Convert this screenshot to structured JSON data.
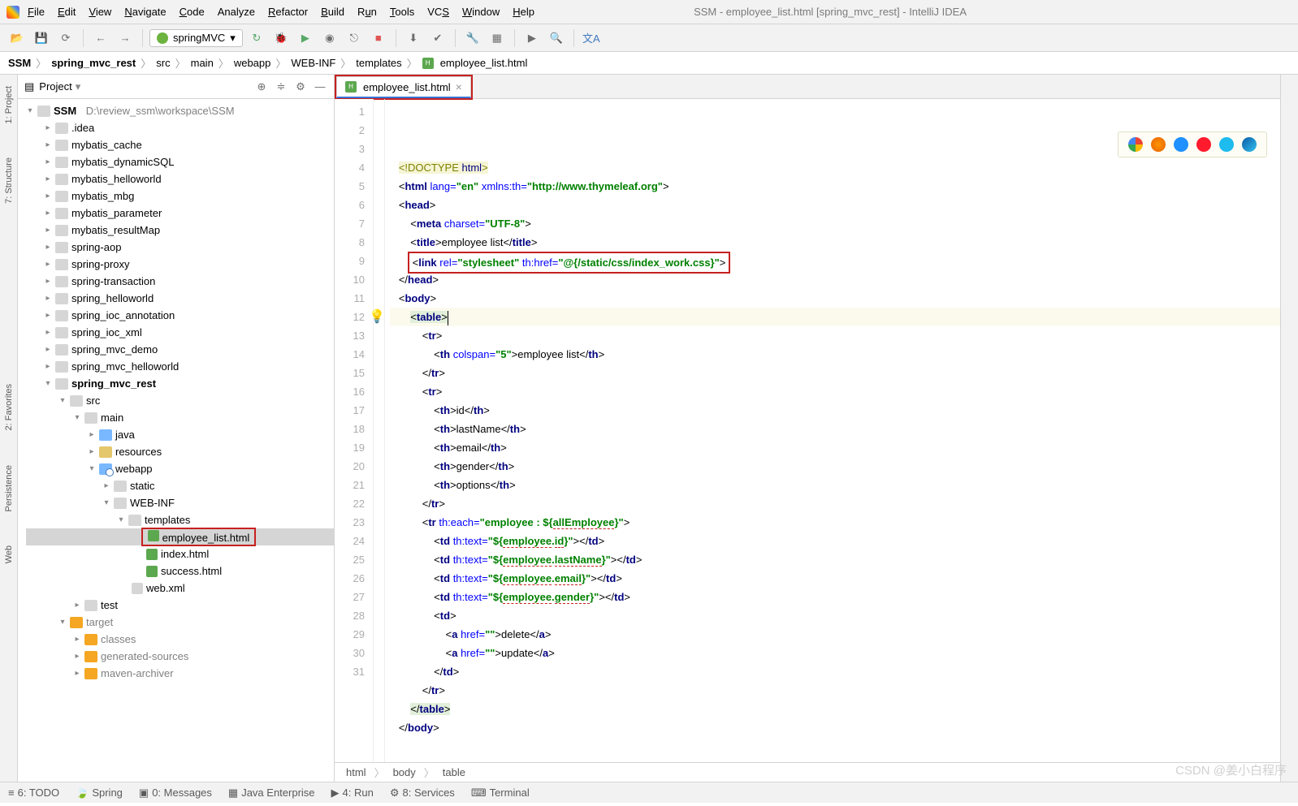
{
  "window_title": "SSM - employee_list.html [spring_mvc_rest] - IntelliJ IDEA",
  "menu": {
    "file": "File",
    "edit": "Edit",
    "view": "View",
    "navigate": "Navigate",
    "code": "Code",
    "analyze": "Analyze",
    "refactor": "Refactor",
    "build": "Build",
    "run": "Run",
    "tools": "Tools",
    "vcs": "VCS",
    "window": "Window",
    "help": "Help"
  },
  "run_config": "springMVC",
  "breadcrumbs": [
    "SSM",
    "spring_mvc_rest",
    "src",
    "main",
    "webapp",
    "WEB-INF",
    "templates",
    "employee_list.html"
  ],
  "project_panel": {
    "title": "Project"
  },
  "tree": {
    "root": "SSM",
    "root_path": "D:\\review_ssm\\workspace\\SSM",
    "mods": [
      ".idea",
      "mybatis_cache",
      "mybatis_dynamicSQL",
      "mybatis_helloworld",
      "mybatis_mbg",
      "mybatis_parameter",
      "mybatis_resultMap",
      "spring-aop",
      "spring-proxy",
      "spring-transaction",
      "spring_helloworld",
      "spring_ioc_annotation",
      "spring_ioc_xml",
      "spring_mvc_demo",
      "spring_mvc_helloworld",
      "spring_mvc_rest"
    ],
    "src": "src",
    "main": "main",
    "java": "java",
    "resources": "resources",
    "webapp": "webapp",
    "static": "static",
    "webinf": "WEB-INF",
    "templates": "templates",
    "file_emp": "employee_list.html",
    "file_index": "index.html",
    "file_success": "success.html",
    "file_web": "web.xml",
    "test": "test",
    "target": "target",
    "classes": "classes",
    "gensrc": "generated-sources",
    "archiver": "maven-archiver"
  },
  "editor": {
    "tab": "employee_list.html",
    "lines": [
      "1",
      "2",
      "3",
      "4",
      "5",
      "6",
      "7",
      "8",
      "9",
      "10",
      "11",
      "12",
      "13",
      "14",
      "15",
      "16",
      "17",
      "18",
      "19",
      "20",
      "21",
      "22",
      "23",
      "24",
      "25",
      "26",
      "27",
      "28",
      "29",
      "30",
      "31"
    ],
    "bc": [
      "html",
      "body",
      "table"
    ]
  },
  "code": {
    "doctype": "<!DOCTYPE ",
    "doctype_kw": "html",
    "html": "html",
    "lang_attr": "lang=",
    "lang_val": "\"en\"",
    "xmlns": "xmlns:th=",
    "xmlns_val": "\"http://www.thymeleaf.org\"",
    "head": "head",
    "meta": "meta",
    "charset": "charset=",
    "charset_val": "\"UTF-8\"",
    "title": "title",
    "title_txt": "employee list",
    "link": "link",
    "rel": "rel=",
    "rel_val": "\"stylesheet\"",
    "thhref": "th:href=",
    "thhref_val": "\"@{/static/css/index_work.css}\"",
    "body": "body",
    "table": "table",
    "tr": "tr",
    "th": "th",
    "td": "td",
    "a": "a",
    "href": "href=",
    "href_val": "\"\"",
    "colspan": "colspan=",
    "colspan_val": "\"5\"",
    "emp_list": "employee list",
    "id": "id",
    "lastName": "lastName",
    "email": "email",
    "gender": "gender",
    "options": "options",
    "theach": "th:each=",
    "theach_val_open": "\"employee : ${",
    "theach_var": "allEmployee",
    "theach_val_close": "}\"",
    "thtext": "th:text=",
    "expr_open": "\"${",
    "expr_close": "}\"",
    "emp": "employee",
    "dot": ".",
    "f_id": "id",
    "f_ln": "lastName",
    "f_em": "email",
    "f_gd": "gender",
    "delete": "delete",
    "update": "update"
  },
  "left_tabs": {
    "project": "1: Project",
    "structure": "7: Structure",
    "favorites": "2: Favorites",
    "persistence": "Persistence",
    "web": "Web"
  },
  "bottom": {
    "todo": "6: TODO",
    "spring": "Spring",
    "messages": "0: Messages",
    "je": "Java Enterprise",
    "run": "4: Run",
    "services": "8: Services",
    "terminal": "Terminal"
  },
  "watermark": "CSDN @姜小白程序"
}
